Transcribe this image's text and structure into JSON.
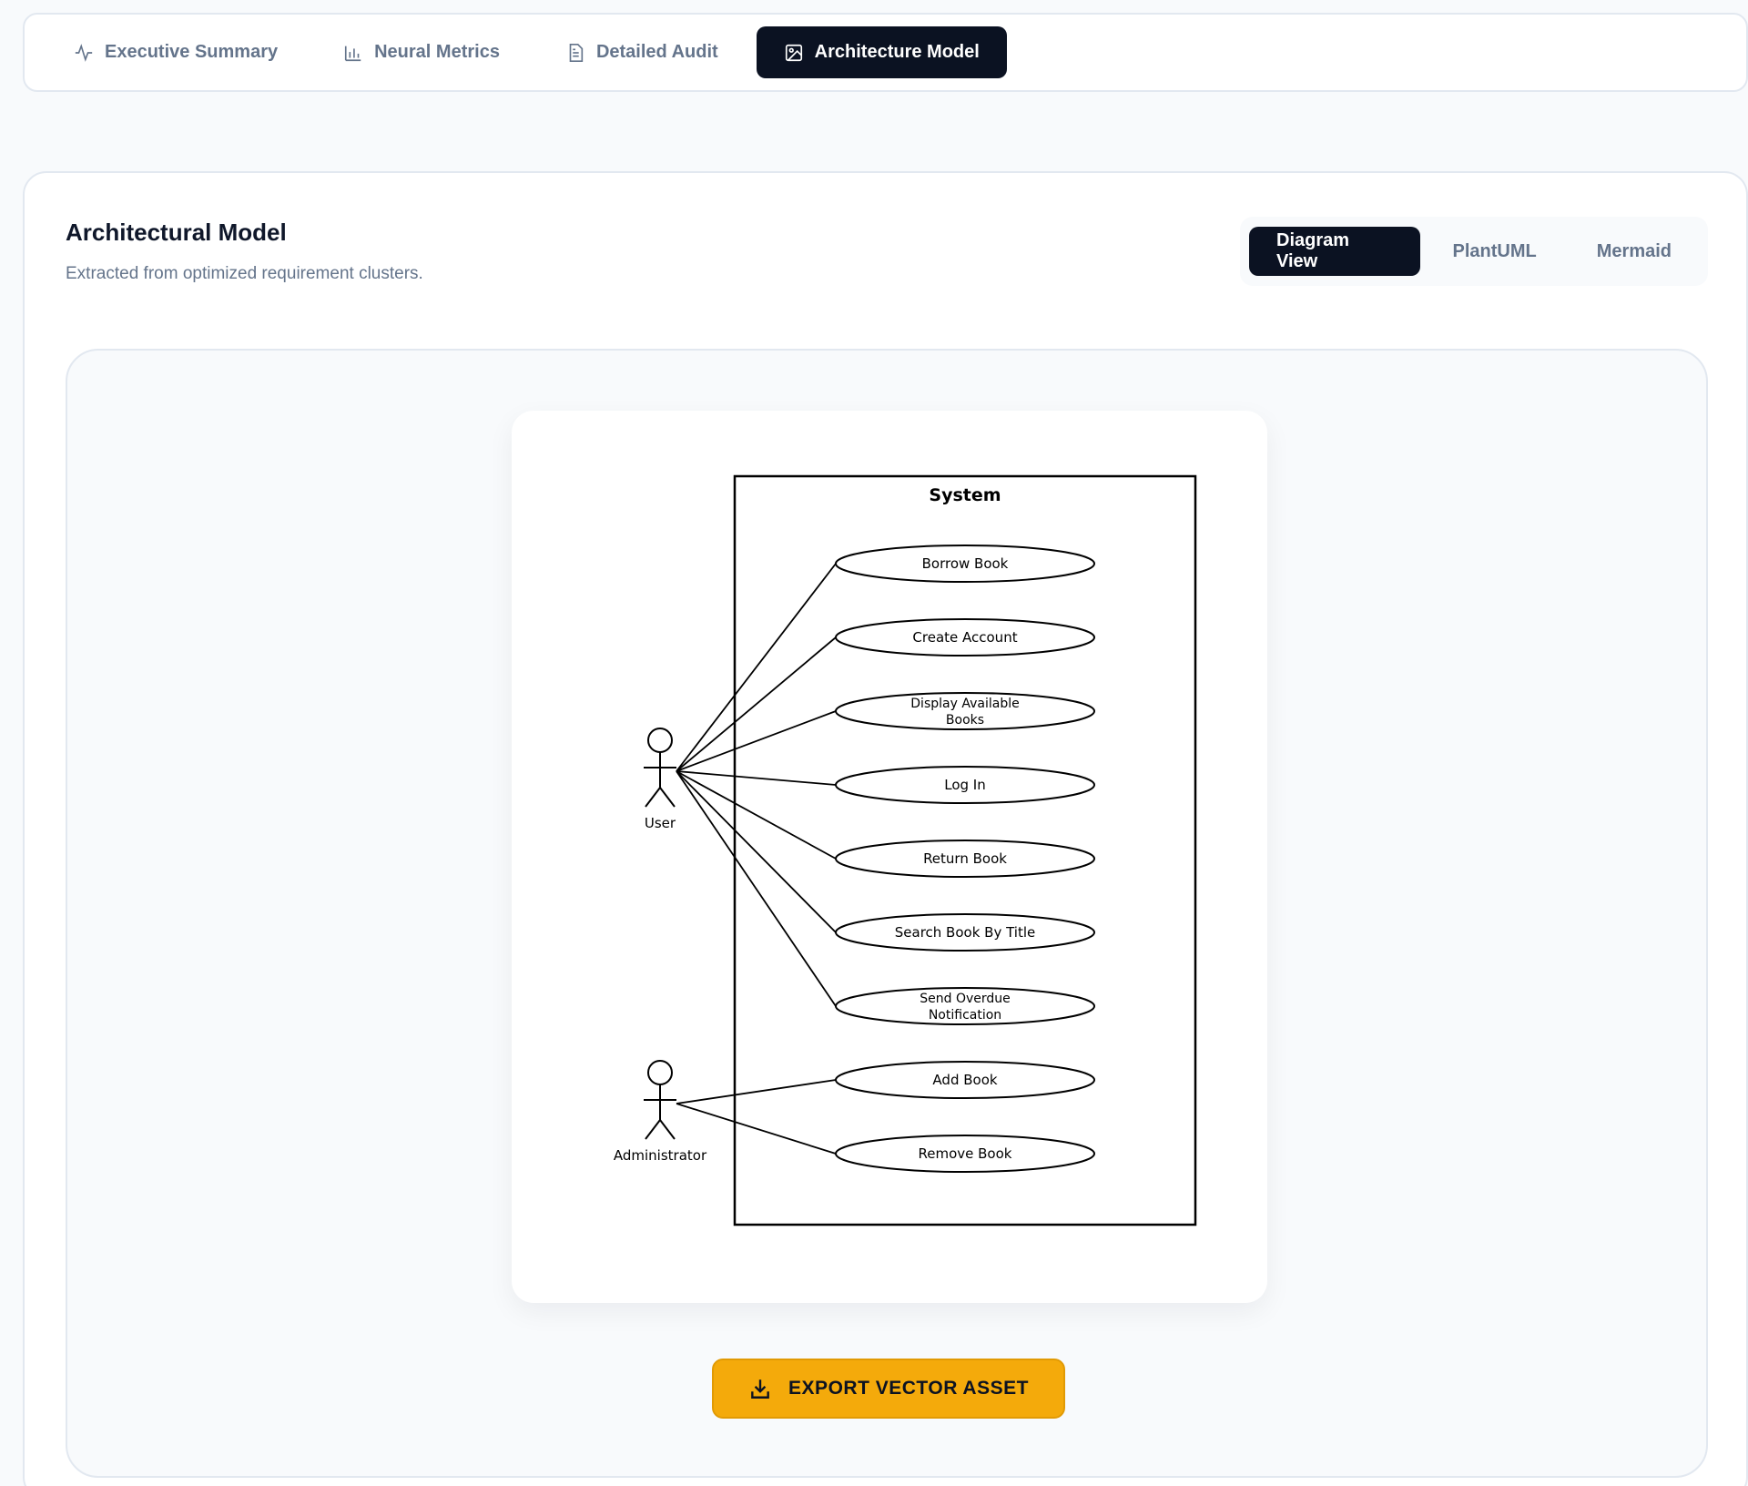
{
  "tabs": [
    {
      "label": "Executive Summary",
      "icon": "activity-icon",
      "active": false
    },
    {
      "label": "Neural Metrics",
      "icon": "bar-chart-icon",
      "active": false
    },
    {
      "label": "Detailed Audit",
      "icon": "document-icon",
      "active": false
    },
    {
      "label": "Architecture Model",
      "icon": "image-icon",
      "active": true
    }
  ],
  "card": {
    "title": "Architectural Model",
    "subtitle": "Extracted from optimized requirement clusters."
  },
  "view_switch": {
    "options": [
      "Diagram View",
      "PlantUML",
      "Mermaid"
    ],
    "selected": "Diagram View"
  },
  "diagram": {
    "system_label": "System",
    "actors": [
      "User",
      "Administrator"
    ],
    "use_cases": [
      [
        "Borrow Book"
      ],
      [
        "Create Account"
      ],
      [
        "Display Available",
        "Books"
      ],
      [
        "Log In"
      ],
      [
        "Return Book"
      ],
      [
        "Search Book By Title"
      ],
      [
        "Send Overdue",
        "Notification"
      ],
      [
        "Add Book"
      ],
      [
        "Remove Book"
      ]
    ],
    "associations": {
      "User": [
        0,
        1,
        2,
        3,
        4,
        5,
        6
      ],
      "Administrator": [
        7,
        8
      ]
    }
  },
  "export": {
    "label": "EXPORT VECTOR ASSET",
    "icon": "download-icon",
    "color": "#f4aa0b"
  },
  "colors": {
    "accent_dark": "#0b1222",
    "background": "#f8fafc"
  }
}
